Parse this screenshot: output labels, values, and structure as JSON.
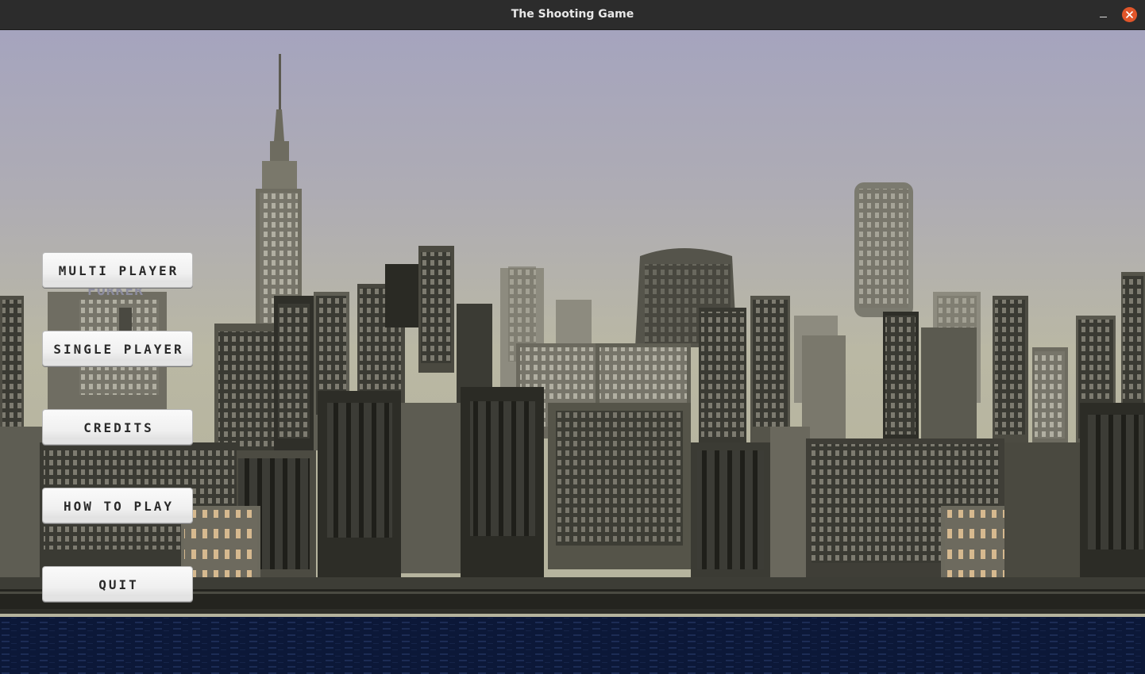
{
  "window": {
    "title": "The Shooting Game"
  },
  "menu": {
    "multi_player": "MULTI PLAYER",
    "single_player": "SINGLE PLAYER",
    "credits": "CREDITS",
    "how_to_play": "HOW TO PLAY",
    "quit": "QUIT"
  },
  "scene": {
    "sign_text": "FORKER"
  },
  "colors": {
    "sky_top": "#a4a3bd",
    "sky_bottom": "#b9b7a3",
    "water": "#0d1a3a",
    "close_button": "#e2562a"
  }
}
